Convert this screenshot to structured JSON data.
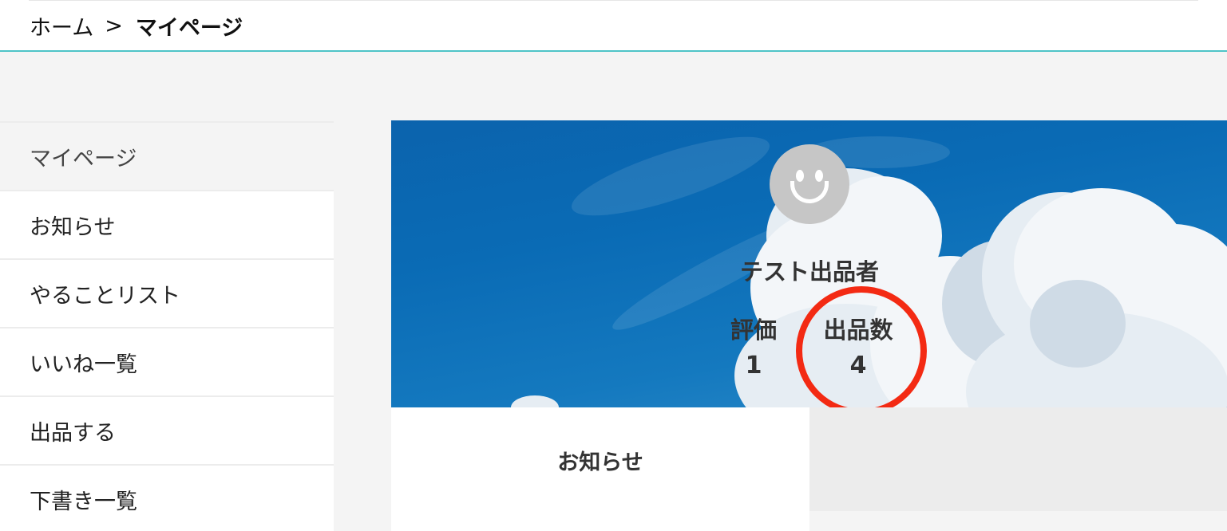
{
  "breadcrumb": {
    "home": "ホーム",
    "separator": ">",
    "current": "マイページ"
  },
  "sidebar": {
    "items": [
      {
        "label": "マイページ",
        "active": true
      },
      {
        "label": "お知らせ",
        "active": false
      },
      {
        "label": "やることリスト",
        "active": false
      },
      {
        "label": "いいね一覧",
        "active": false
      },
      {
        "label": "出品する",
        "active": false
      },
      {
        "label": "下書き一覧",
        "active": false
      }
    ]
  },
  "profile": {
    "avatar_icon": "smiley-face-icon",
    "name": "テスト出品者",
    "stats": {
      "rating_label": "評価",
      "rating_value": "1",
      "listings_label": "出品数",
      "listings_value": "4"
    }
  },
  "tabs": {
    "news_label": "お知らせ"
  },
  "colors": {
    "accent_line": "#4ec3c7",
    "highlight_ring": "#f32a13",
    "sky": "#0a6bb5"
  }
}
